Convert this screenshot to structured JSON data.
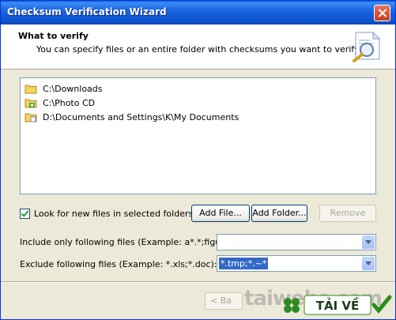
{
  "window": {
    "title": "Checksum Verification Wizard"
  },
  "header": {
    "title": "What to verify",
    "subtitle": "You can specify files or an entire folder with checksums you want to verify."
  },
  "list": {
    "items": [
      {
        "path": "C:\\Downloads",
        "icon": "folder-icon"
      },
      {
        "path": "C:\\Photo CD",
        "icon": "folder-add-icon"
      },
      {
        "path": "D:\\Documents and Settings\\K\\My Documents",
        "icon": "folder-icon"
      }
    ]
  },
  "options": {
    "look_new_files_label": "Look for new files in selected folders",
    "look_new_files_checked": true
  },
  "buttons": {
    "add_file": "Add File...",
    "add_folder": "Add Folder...",
    "remove": "Remove",
    "back": "< Ba"
  },
  "include": {
    "label": "Include only following files (Example: a*.*;figure*.*):",
    "value": ""
  },
  "exclude": {
    "label": "Exclude following files (Example: *.xls;*.doc):",
    "value": "*.tmp;*.~*"
  },
  "watermark": {
    "text": "taiwebs.com"
  },
  "logo": {
    "text": "TẢI VỀ"
  },
  "colors": {
    "titlebar": "#0a5fd8",
    "dialog_bg": "#ece9d8",
    "selection": "#316ac5",
    "logo_green": "#2e8b1e"
  }
}
